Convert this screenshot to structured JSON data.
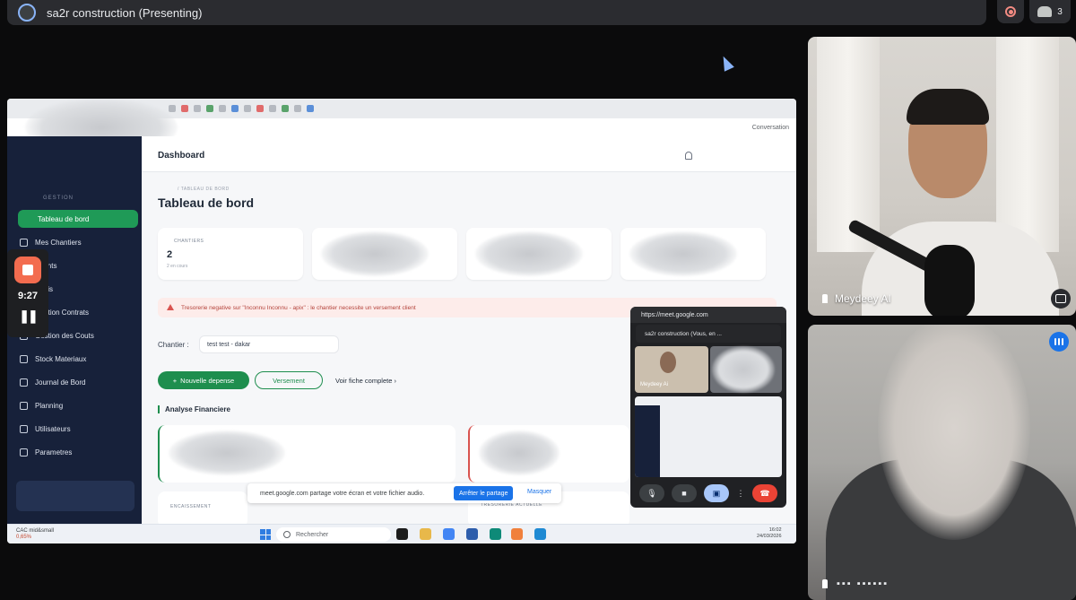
{
  "meet": {
    "title": "sa2r construction (Presenting)",
    "participant_count": "3"
  },
  "recorder": {
    "time": "9:27",
    "pause_symbol": "❚❚"
  },
  "browser": {
    "profile_label": "Conversation"
  },
  "sidebar": {
    "section": "GESTION",
    "items": [
      {
        "label": "Tableau de bord",
        "active": true
      },
      {
        "label": "Mes Chantiers"
      },
      {
        "label": "Clients"
      },
      {
        "label": "Devis"
      },
      {
        "label": "Gestion Contrats"
      },
      {
        "label": "Gestion des Couts"
      },
      {
        "label": "Stock Materiaux"
      },
      {
        "label": "Journal de Bord"
      },
      {
        "label": "Planning"
      },
      {
        "label": "Utilisateurs"
      },
      {
        "label": "Parametres"
      }
    ]
  },
  "dashboard": {
    "header": "Dashboard",
    "breadcrumb": "/ TABLEAU DE BORD",
    "title": "Tableau de bord",
    "cards": [
      {
        "label": "CHANTIERS",
        "value": "2",
        "sub": "2 en cours"
      }
    ],
    "alert": "Tresorerie negative sur \"Inconnu Inconnu - apix\" : le chantier necessite un versement client",
    "chantier_label": "Chantier :",
    "chantier_value": "test test - dakar",
    "btn_new_expense": "Nouvelle depense",
    "btn_payment": "Versement",
    "link_full": "Voir fiche complete",
    "section_title": "Analyse Financiere",
    "label_encaissement": "ENCAISSEMENT",
    "label_tresorerie": "TRESORERIE ACTUELLE"
  },
  "share_banner": {
    "text": "meet.google.com partage votre écran et votre fichier audio.",
    "stop": "Arrêter le partage",
    "hide": "Masquer"
  },
  "taskbar": {
    "weather_title": "CAC mid&small",
    "weather_sub": "0,65%",
    "search": "Rechercher",
    "time": "16:02",
    "date": "24/03/2026"
  },
  "pip": {
    "url": "https://meet.google.com",
    "title": "sa2r construction (Vous, en ...",
    "tile_name": "Meydeey Ai"
  },
  "tiles": {
    "main_name": "Meydeey AI",
    "other_name": "▪▪▪ ▪▪▪▪▪▪"
  }
}
